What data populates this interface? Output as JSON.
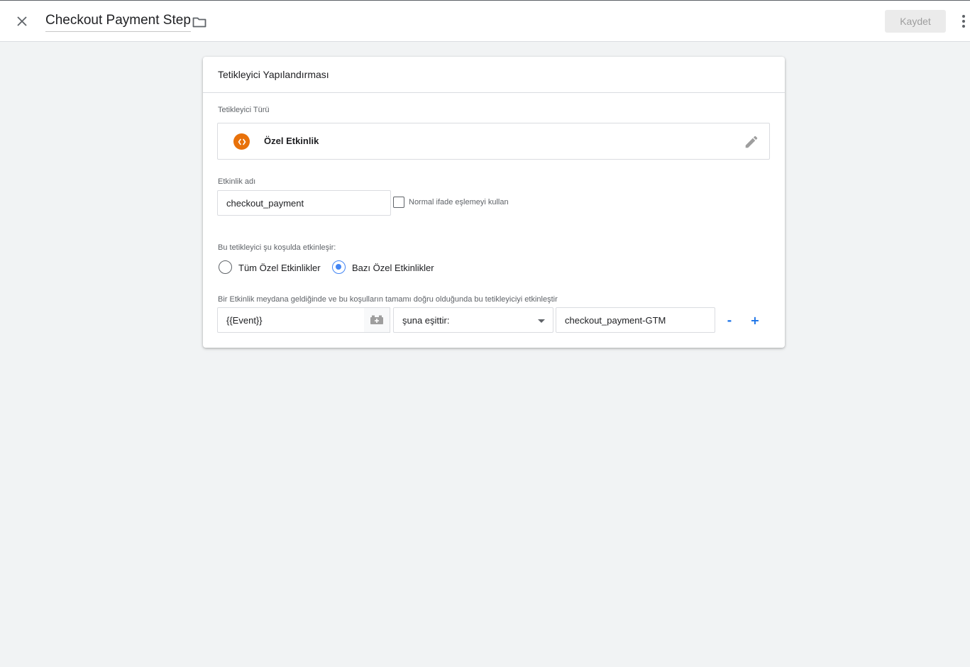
{
  "header": {
    "title": "Checkout Payment Step",
    "save_label": "Kaydet"
  },
  "card": {
    "title": "Tetikleyici Yapılandırması",
    "trigger_type_label": "Tetikleyici Türü",
    "trigger_type_value": "Özel Etkinlik",
    "trigger_type_icon": "custom-event-code-icon",
    "trigger_type_icon_color": "#e8710a",
    "event_name_label": "Etkinlik adı",
    "event_name_value": "checkout_payment",
    "regex_label": "Normal ifade eşlemeyi kullan",
    "regex_checked": false,
    "fires_on_label": "Bu tetikleyici şu koşulda etkinleşir:",
    "options": [
      {
        "label": "Tüm Özel Etkinlikler",
        "selected": false
      },
      {
        "label": "Bazı Özel Etkinlikler",
        "selected": true
      }
    ],
    "condition_label": "Bir Etkinlik meydana geldiğinde ve bu koşulların tamamı doğru olduğunda bu tetikleyiciyi etkinleştir",
    "condition": {
      "variable": "{{Event}}",
      "operator": "şuna eşittir:",
      "value": "checkout_payment-GTM",
      "remove_label": "-",
      "add_label": "+"
    }
  },
  "colors": {
    "accent": "#1a73e8",
    "radio_selected": "#4285f4",
    "background": "#f1f3f4"
  }
}
